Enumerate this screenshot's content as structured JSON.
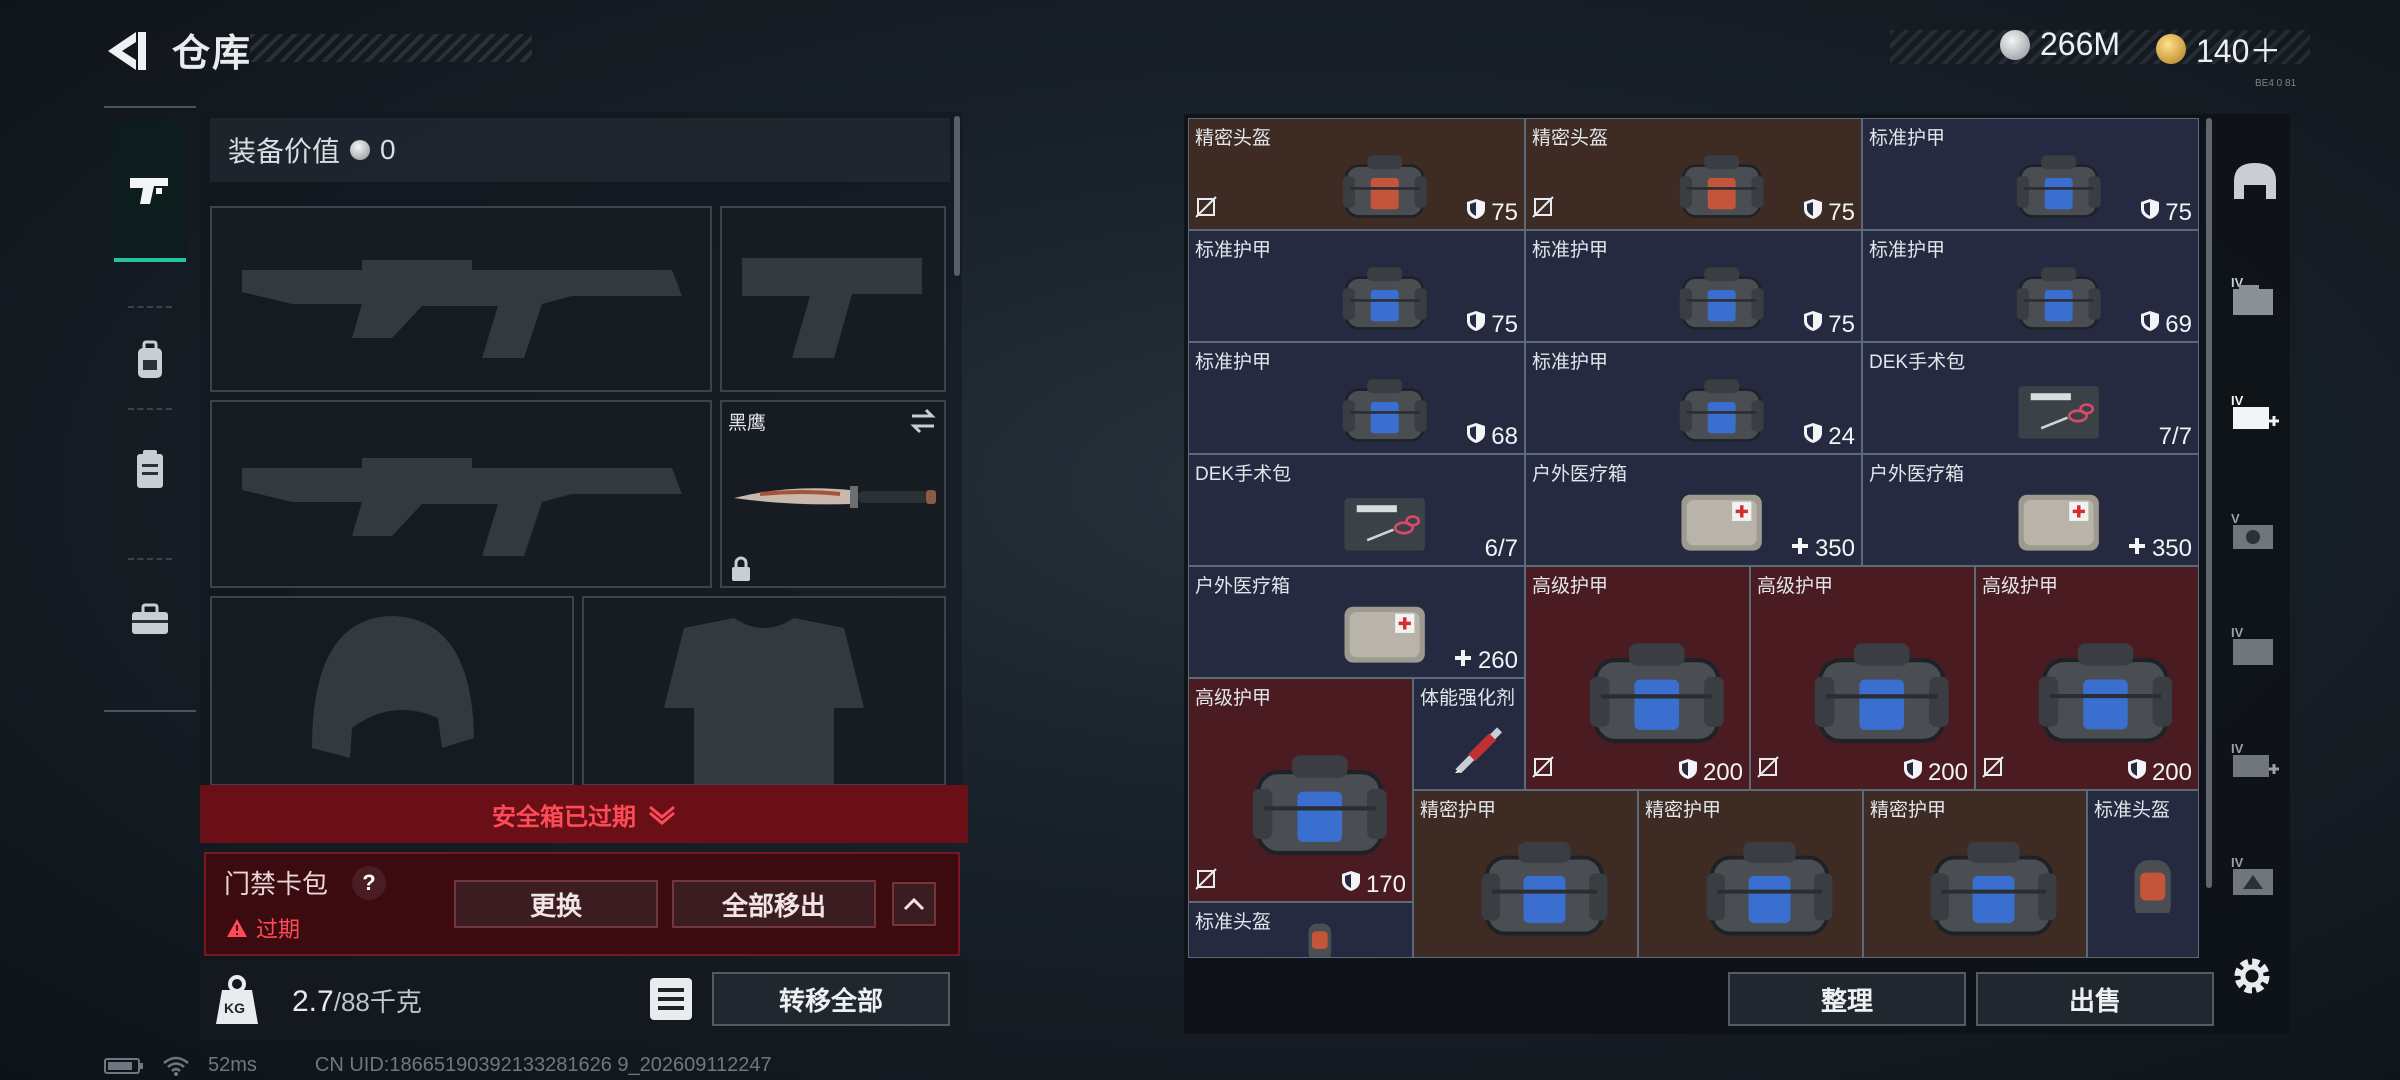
{
  "header": {
    "title": "仓库",
    "currency": [
      {
        "icon": "silver-coin-icon",
        "value": "266M"
      },
      {
        "icon": "gold-triangle-coin-icon",
        "value": "140＋"
      }
    ],
    "version_tag": "BE4 0 81"
  },
  "rail": {
    "items": [
      {
        "name": "weapons",
        "icon": "pistol-icon",
        "active": true
      },
      {
        "name": "gear",
        "icon": "backpack-icon",
        "active": false
      },
      {
        "name": "consumables",
        "icon": "clipboard-icon",
        "active": false
      },
      {
        "name": "toolbox",
        "icon": "toolbox-icon",
        "active": false
      }
    ]
  },
  "equipment": {
    "value_label": "装备价值",
    "value": "0",
    "melee_name": "黑鹰",
    "safebox_status": "安全箱已过期",
    "keycard": {
      "title": "门禁卡包",
      "help": "?",
      "status": "过期",
      "replace_label": "更换",
      "remove_all_label": "全部移出"
    },
    "weight": "2.7",
    "weight_max": "/88千克",
    "weight_badge": "KG",
    "transfer_all_label": "转移全部"
  },
  "status_bar": {
    "ping": "52ms",
    "uid": "CN UID:18665190392133281626 9_202609112247"
  },
  "stash": {
    "items": [
      {
        "name": "精密头盔",
        "value": "75",
        "bg": "brown",
        "kind": "bag-orange",
        "nrs": true,
        "vicon": "shield"
      },
      {
        "name": "精密头盔",
        "value": "75",
        "bg": "brown",
        "kind": "bag-orange",
        "nrs": true,
        "vicon": "shield"
      },
      {
        "name": "标准护甲",
        "value": "75",
        "bg": "navy",
        "kind": "bag-blue",
        "nrs": false,
        "vicon": "shield"
      },
      {
        "name": "标准护甲",
        "value": "75",
        "bg": "navy",
        "kind": "bag-blue",
        "nrs": false,
        "vicon": "shield"
      },
      {
        "name": "标准护甲",
        "value": "75",
        "bg": "navy",
        "kind": "bag-blue",
        "nrs": false,
        "vicon": "shield"
      },
      {
        "name": "标准护甲",
        "value": "69",
        "bg": "navy",
        "kind": "bag-blue",
        "nrs": false,
        "vicon": "shield"
      },
      {
        "name": "标准护甲",
        "value": "68",
        "bg": "navy",
        "kind": "bag-blue",
        "nrs": false,
        "vicon": "shield"
      },
      {
        "name": "标准护甲",
        "value": "24",
        "bg": "navy",
        "kind": "bag-blue",
        "nrs": false,
        "vicon": "shield"
      },
      {
        "name": "DEK手术包",
        "value": "7/7",
        "bg": "navy",
        "kind": "surgery",
        "nrs": false,
        "vicon": ""
      },
      {
        "name": "DEK手术包",
        "value": "6/7",
        "bg": "navy",
        "kind": "surgery",
        "nrs": false,
        "vicon": ""
      },
      {
        "name": "户外医疗箱",
        "value": "350",
        "bg": "navy",
        "kind": "medbox",
        "nrs": false,
        "vicon": "plus"
      },
      {
        "name": "户外医疗箱",
        "value": "350",
        "bg": "navy",
        "kind": "medbox",
        "nrs": false,
        "vicon": "plus"
      },
      {
        "name": "户外医疗箱",
        "value": "260",
        "bg": "navy",
        "kind": "medbox",
        "nrs": false,
        "vicon": "plus"
      },
      {
        "name": "高级护甲",
        "value": "200",
        "bg": "red",
        "kind": "bag-big",
        "nrs": true,
        "vicon": "shield"
      },
      {
        "name": "高级护甲",
        "value": "200",
        "bg": "red",
        "kind": "bag-big",
        "nrs": true,
        "vicon": "shield"
      },
      {
        "name": "高级护甲",
        "value": "200",
        "bg": "red",
        "kind": "bag-big",
        "nrs": true,
        "vicon": "shield"
      },
      {
        "name": "高级护甲",
        "value": "170",
        "bg": "red",
        "kind": "bag-big",
        "nrs": true,
        "vicon": "shield"
      },
      {
        "name": "体能强化剂",
        "value": "",
        "bg": "navy",
        "kind": "syringe",
        "nrs": false,
        "vicon": ""
      },
      {
        "name": "精密护甲",
        "value": "",
        "bg": "brown",
        "kind": "bag-big",
        "nrs": false,
        "vicon": ""
      },
      {
        "name": "精密护甲",
        "value": "",
        "bg": "brown",
        "kind": "bag-big",
        "nrs": false,
        "vicon": ""
      },
      {
        "name": "精密护甲",
        "value": "",
        "bg": "brown",
        "kind": "bag-big",
        "nrs": false,
        "vicon": ""
      },
      {
        "name": "标准头盔",
        "value": "",
        "bg": "navy",
        "kind": "helmet",
        "nrs": false,
        "vicon": ""
      },
      {
        "name": "标准头盔",
        "value": "",
        "bg": "navy",
        "kind": "helmet",
        "nrs": false,
        "vicon": ""
      }
    ],
    "sort_label": "整理",
    "sell_label": "出售"
  },
  "side_tools": [
    {
      "name": "helmet-filter-icon",
      "tier": ""
    },
    {
      "name": "case-tier-4-icon",
      "tier": "IV"
    },
    {
      "name": "medkit-tier-4-icon",
      "tier": "IV"
    },
    {
      "name": "bag-tier-5-icon",
      "tier": "V"
    },
    {
      "name": "case-tier-4b-icon",
      "tier": "IV"
    },
    {
      "name": "medkit-tier-4b-icon",
      "tier": "IV"
    },
    {
      "name": "item-tier-4-icon",
      "tier": "IV"
    },
    {
      "name": "settings-gear-icon",
      "tier": ""
    }
  ],
  "colors": {
    "accent_green": "#26c39a",
    "expired_red": "#ff4b58",
    "cell_brown": "#3e2c24",
    "cell_navy": "#262a40",
    "cell_red": "#4a1c22"
  }
}
